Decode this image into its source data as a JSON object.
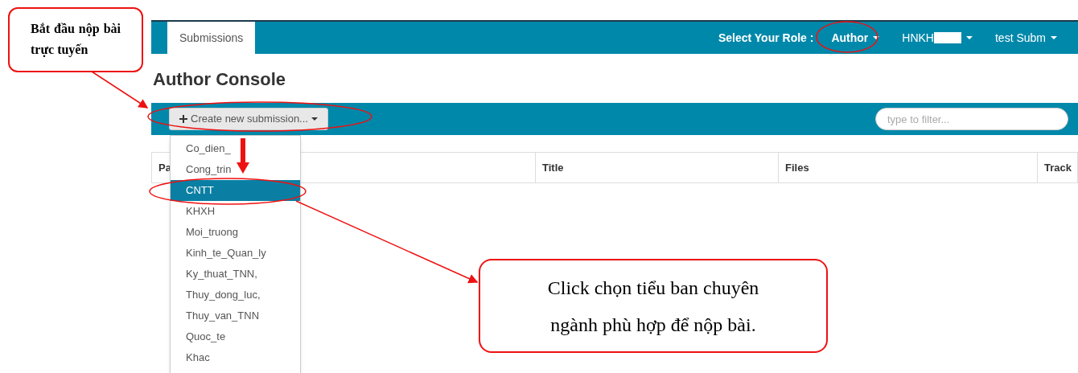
{
  "header": {
    "tabs": [
      {
        "label": "Submissions",
        "selected": true
      }
    ],
    "role_label": "Select Your Role :",
    "menus": [
      {
        "label": "Author",
        "redacted": false
      },
      {
        "label": "HNKH",
        "redacted": true
      },
      {
        "label": "test Subm",
        "redacted": false
      }
    ]
  },
  "page_title": "Author Console",
  "toolbar": {
    "create_button": "Create new submission...",
    "filter": {
      "placeholder": "type to filter..."
    }
  },
  "dropdown": {
    "items": [
      {
        "label": "Co_dien_",
        "selected": false
      },
      {
        "label": "Cong_trin",
        "selected": false
      },
      {
        "label": "CNTT",
        "selected": true
      },
      {
        "label": "KHXH",
        "selected": false
      },
      {
        "label": "Moi_truong",
        "selected": false
      },
      {
        "label": "Kinh_te_Quan_ly",
        "selected": false
      },
      {
        "label": "Ky_thuat_TNN,",
        "selected": false
      },
      {
        "label": "Thuy_dong_luc,",
        "selected": false
      },
      {
        "label": "Thuy_van_TNN",
        "selected": false
      },
      {
        "label": "Quoc_te",
        "selected": false
      },
      {
        "label": "Khac",
        "selected": false
      }
    ]
  },
  "table": {
    "columns": [
      "Pa",
      "Title",
      "Files",
      "Track"
    ]
  },
  "callouts": [
    {
      "text": "Bắt đầu nộp bài trực tuyến"
    },
    {
      "text": "Click chọn tiểu ban chuyên ngành phù hợp để nộp bài."
    }
  ]
}
